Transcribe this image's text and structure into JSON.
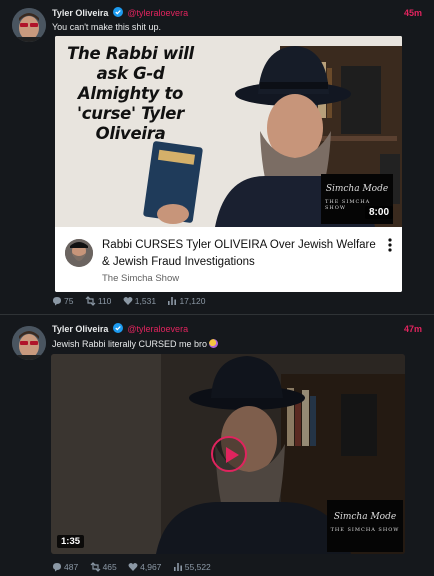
{
  "tweets": [
    {
      "author_name": "Tyler Oliveira",
      "handle": "@tyleraloevera",
      "time": "45m",
      "text": "You can't make this shit up.",
      "card": {
        "overlay_text": "The Rabbi will ask G-d Almighty to 'curse' Tyler Oliveira",
        "duration": "8:00",
        "logo_signature": "Simcha Mode",
        "logo_show": "THE SIMCHA SHOW",
        "title": "Rabbi CURSES Tyler OLIVEIRA Over Jewish Welfare & Jewish Fraud Investigations",
        "channel": "The Simcha Show"
      },
      "stats": {
        "replies": "75",
        "retweets": "110",
        "likes": "1,531",
        "views": "17,120"
      }
    },
    {
      "author_name": "Tyler Oliveira",
      "handle": "@tyleraloevera",
      "time": "47m",
      "text": "Jewish Rabbi literally CURSED me bro",
      "video": {
        "duration": "1:35",
        "logo_signature": "Simcha Mode",
        "logo_show": "THE SIMCHA SHOW"
      },
      "stats": {
        "replies": "487",
        "retweets": "465",
        "likes": "4,967",
        "views": "55,522"
      }
    }
  ],
  "icons": {
    "verified": "verified-badge-icon",
    "reply": "reply-icon",
    "retweet": "retweet-icon",
    "like": "heart-icon",
    "views": "views-icon",
    "more": "more-vertical-icon",
    "play": "play-icon"
  },
  "colors": {
    "background": "#15181c",
    "accent": "#e0245e",
    "verified": "#1d9bf0",
    "muted": "#8b98a5"
  }
}
